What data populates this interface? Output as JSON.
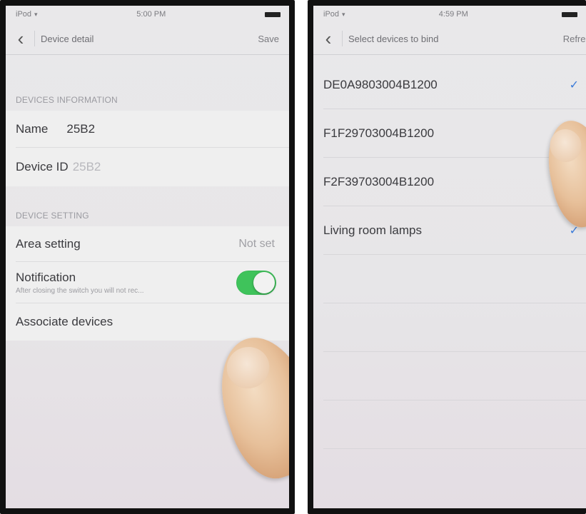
{
  "left_screen": {
    "status_bar": {
      "device": "iPod",
      "time": "5:00 PM"
    },
    "nav": {
      "title": "Device detail",
      "action": "Save"
    },
    "devices_information": {
      "header": "DEVICES INFORMATION",
      "name_label": "Name",
      "name_value": "25B2",
      "device_id_label": "Device ID",
      "device_id_value": "25B2"
    },
    "device_setting": {
      "header": "DEVICE SETTING",
      "area_label": "Area setting",
      "area_value": "Not set",
      "notification_label": "Notification",
      "notification_subtext": "After closing  the switch you will not rec...",
      "notification_on": true,
      "associate_label": "Associate devices"
    }
  },
  "right_screen": {
    "status_bar": {
      "device": "iPod",
      "time": "4:59 PM"
    },
    "nav": {
      "title": "Select devices to bind",
      "action": "Refres"
    },
    "devices": [
      {
        "label": "DE0A9803004B1200",
        "checked": true
      },
      {
        "label": "F1F29703004B1200",
        "checked": false
      },
      {
        "label": "F2F39703004B1200",
        "checked": false
      },
      {
        "label": "Living room lamps",
        "checked": true
      }
    ]
  },
  "icons": {
    "back": "chevron-left-icon",
    "check": "checkmark-icon",
    "wifi": "wifi-icon",
    "battery": "battery-icon"
  },
  "colors": {
    "toggle_on": "#3fc35b",
    "checkmark": "#3b7bd9",
    "background": "#e9e8ea"
  }
}
